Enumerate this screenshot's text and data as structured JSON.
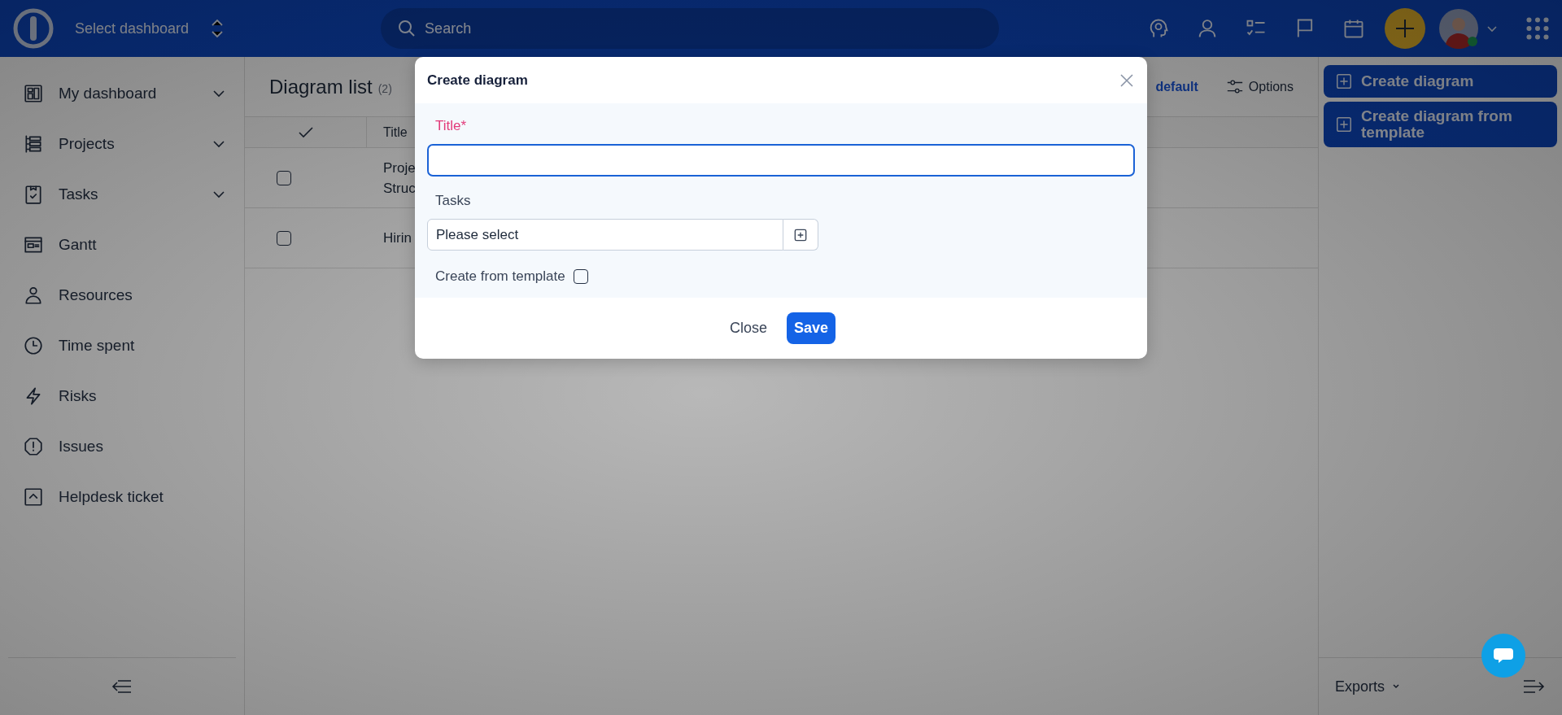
{
  "topbar": {
    "dashboard_selector": "Select dashboard",
    "search": {
      "placeholder": "Search"
    }
  },
  "sidebar": {
    "items": [
      {
        "label": "My dashboard",
        "expandable": true
      },
      {
        "label": "Projects",
        "expandable": true
      },
      {
        "label": "Tasks",
        "expandable": true
      },
      {
        "label": "Gantt",
        "expandable": false
      },
      {
        "label": "Resources",
        "expandable": false
      },
      {
        "label": "Time spent",
        "expandable": false
      },
      {
        "label": "Risks",
        "expandable": false
      },
      {
        "label": "Issues",
        "expandable": false
      },
      {
        "label": "Helpdesk ticket",
        "expandable": false
      }
    ]
  },
  "page": {
    "title": "Diagram list",
    "count": "(2)",
    "actions": [
      {
        "label": "default",
        "kind": "link"
      },
      {
        "label": "Options",
        "kind": "options"
      }
    ]
  },
  "table": {
    "columns": [
      "Title"
    ],
    "rows": [
      {
        "title": [
          "Proje",
          "Struc"
        ],
        "checked": false
      },
      {
        "title": [
          "Hirin"
        ],
        "checked": false
      }
    ]
  },
  "right_panel": {
    "buttons": [
      "Create diagram",
      "Create diagram from template"
    ],
    "exports": "Exports"
  },
  "dialog": {
    "title": "Create diagram",
    "fields": [
      {
        "kind": "text",
        "label": "Title*",
        "required": true,
        "focused": true
      },
      {
        "kind": "select",
        "label": "Tasks",
        "placeholder": "Please select"
      },
      {
        "kind": "checkbox",
        "label": "Create from template",
        "checked": false
      }
    ],
    "buttons": [
      {
        "label": "Close",
        "kind": "secondary"
      },
      {
        "label": "Save",
        "kind": "primary"
      }
    ]
  }
}
